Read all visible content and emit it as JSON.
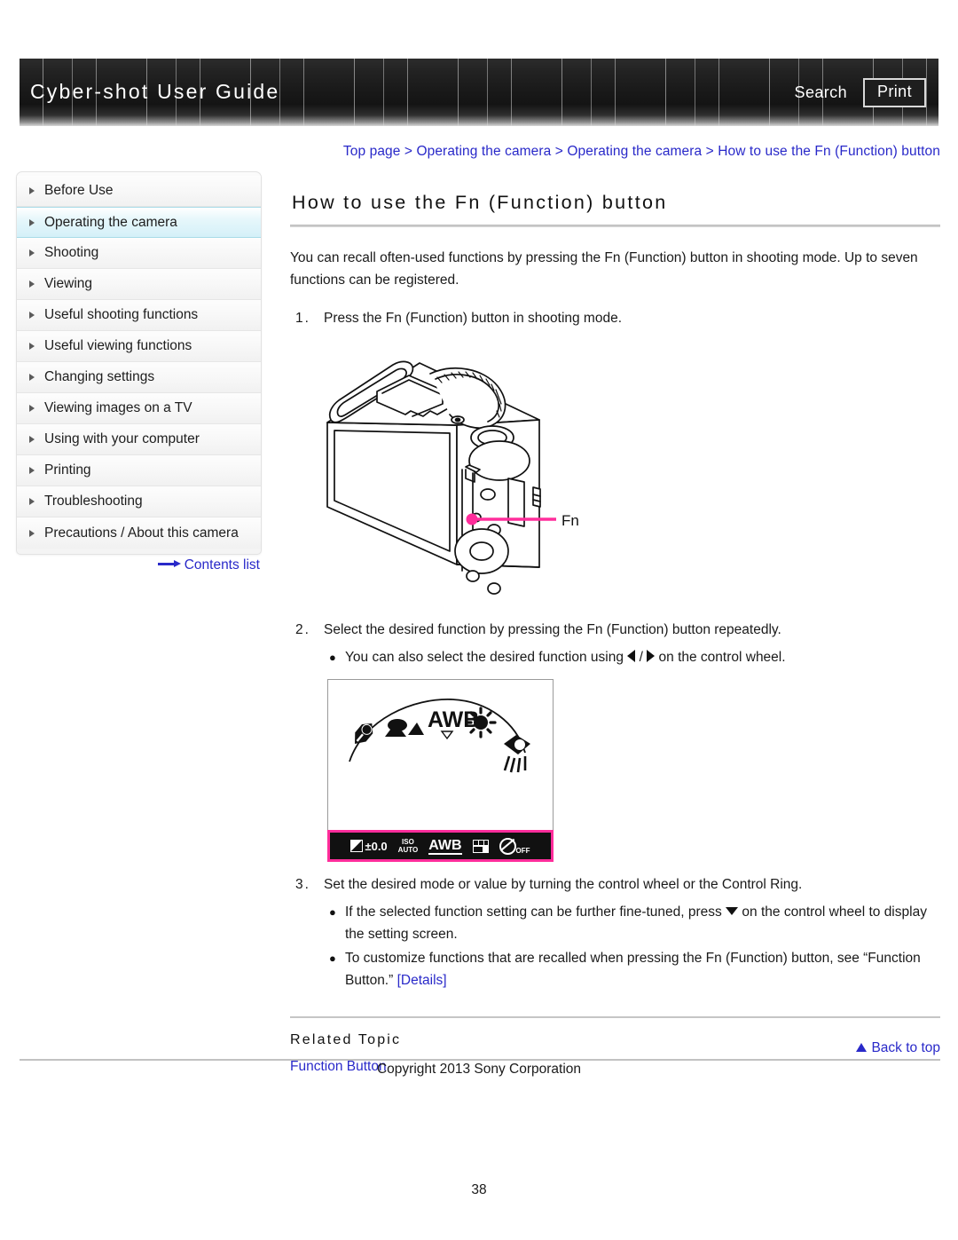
{
  "header": {
    "title": "Cyber-shot User Guide",
    "search_label": "Search",
    "print_label": "Print"
  },
  "breadcrumb": {
    "text": "Top page > Operating the camera > Operating the camera > How to use the Fn (Function) button"
  },
  "sidebar": {
    "items": [
      {
        "label": "Before Use",
        "active": false
      },
      {
        "label": "Operating the camera",
        "active": true
      },
      {
        "label": "Shooting",
        "active": false
      },
      {
        "label": "Viewing",
        "active": false
      },
      {
        "label": "Useful shooting functions",
        "active": false
      },
      {
        "label": "Useful viewing functions",
        "active": false
      },
      {
        "label": "Changing settings",
        "active": false
      },
      {
        "label": "Viewing images on a TV",
        "active": false
      },
      {
        "label": "Using with your computer",
        "active": false
      },
      {
        "label": "Printing",
        "active": false
      },
      {
        "label": "Troubleshooting",
        "active": false
      },
      {
        "label": "Precautions / About this camera",
        "active": false
      }
    ],
    "contents_link": "Contents list"
  },
  "main": {
    "title": "How to use the Fn (Function) button",
    "intro": "You can recall often-used functions by pressing the Fn (Function) button in shooting mode. Up to seven functions can be registered.",
    "step1": {
      "num": "1.",
      "text": "Press the Fn (Function) button in shooting mode."
    },
    "figure_camera": {
      "callout_label": "Fn",
      "callout_color": "#ff2d9b"
    },
    "step2": {
      "num": "2.",
      "text": "Select the desired function by pressing the Fn (Function) button repeatedly.",
      "bullet_a_part1": "You can also select the desired function using",
      "bullet_a_sep": "/",
      "bullet_a_part2": "on the control wheel."
    },
    "figure_screen": {
      "arc_items": [
        "flash-wb-icon",
        "cloudy-wb-icon",
        "AWB",
        "daylight-wb-icon",
        "incandescent-wb-icon"
      ],
      "arc_label": "AWB",
      "statusbar_items": [
        "exposure-comp ±0.0",
        "ISO AUTO",
        "AWB",
        "drive-mode-icon",
        "flash-off-icon"
      ],
      "statusbar_highlight_color": "#ff2d9b"
    },
    "step3": {
      "num": "3.",
      "text": "Set the desired mode or value by turning the control wheel or the Control Ring.",
      "bullet_a_part1": "If the selected function setting can be further fine-tuned, press",
      "bullet_a_part2": "on the control wheel to display the setting screen.",
      "bullet_b_part1": "To customize functions that are recalled when pressing the Fn (Function) button, see “Function Button.”",
      "bullet_b_link": "[Details]"
    },
    "related": {
      "heading": "Related Topic",
      "link": "Function Button"
    }
  },
  "footer": {
    "back_to_top": "Back to top",
    "copyright": "Copyright 2013 Sony Corporation",
    "page_number": "38"
  }
}
